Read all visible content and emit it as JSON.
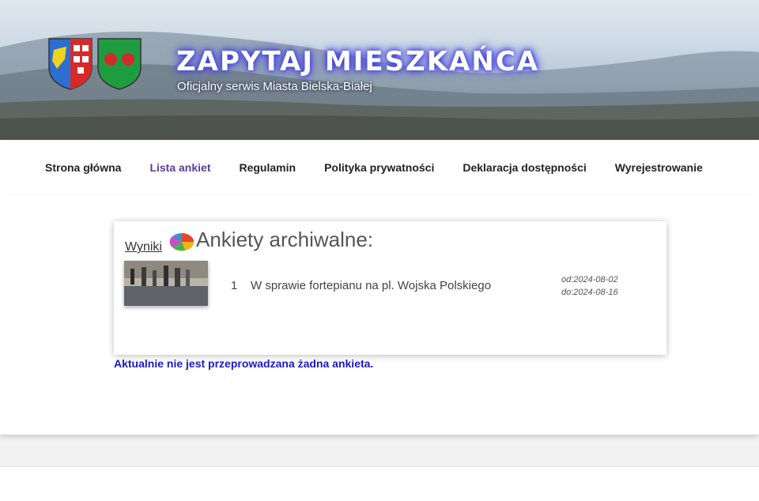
{
  "header": {
    "title": "ZAPYTAJ MIESZKAŃCA",
    "subtitle": "Oficjalny serwis Miasta Bielska-Białej"
  },
  "nav": {
    "items": [
      {
        "label": "Strona główna"
      },
      {
        "label": "Lista ankiet"
      },
      {
        "label": "Regulamin"
      },
      {
        "label": "Polityka prywatności"
      },
      {
        "label": "Deklaracja dostępności"
      },
      {
        "label": "Wyrejestrowanie"
      }
    ],
    "active_index": 1,
    "active_color": "#5a3d9a"
  },
  "archive": {
    "results_label": "Wyniki",
    "heading": "Ankiety archiwalne:",
    "rows": [
      {
        "number": "1",
        "title": "W sprawie fortepianu na pl. Wojska Polskiego",
        "from": "od:2024-08-02",
        "to": "do:2024-08-16"
      }
    ]
  },
  "notice": {
    "text": "Aktualnie nie jest przeprowadzana żadna ankieta.",
    "color": "#1a1ac9"
  }
}
